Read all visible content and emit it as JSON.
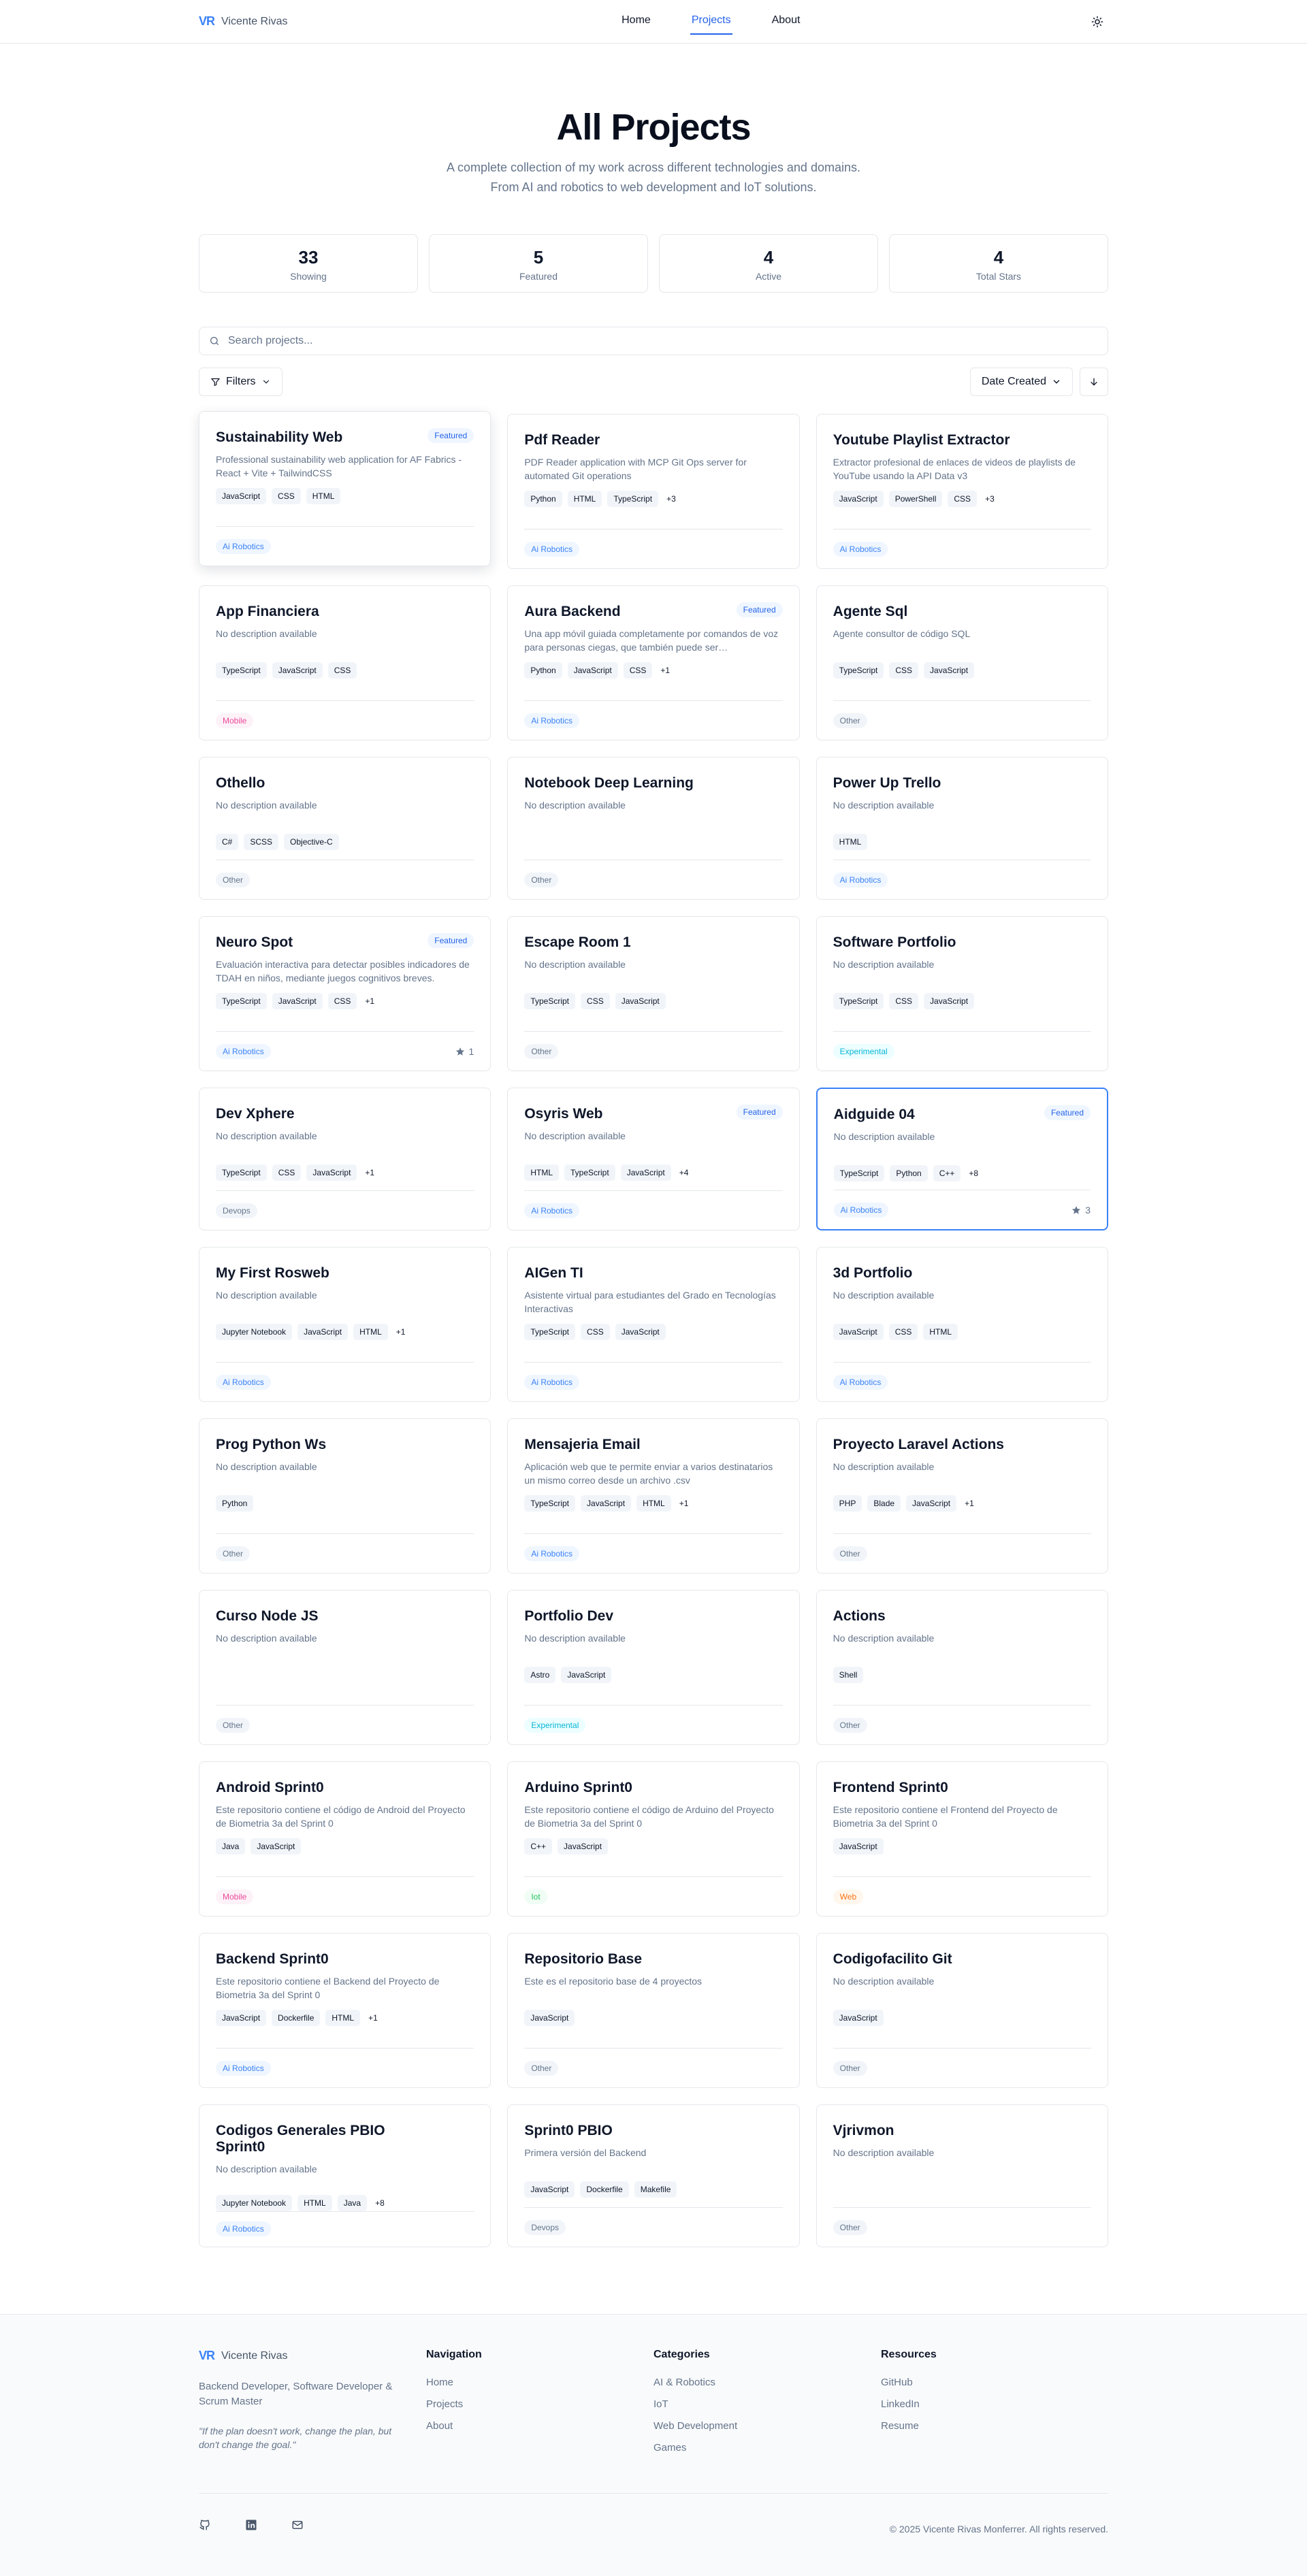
{
  "nav": {
    "brand_logo": "VR",
    "brand_name": "Vicente Rivas",
    "links": [
      "Home",
      "Projects",
      "About"
    ]
  },
  "hero": {
    "title": "All Projects",
    "subtitle_line1": "A complete collection of my work across different technologies and domains.",
    "subtitle_line2": "From AI and robotics to web development and IoT solutions."
  },
  "stats": [
    {
      "value": "33",
      "label": "Showing"
    },
    {
      "value": "5",
      "label": "Featured"
    },
    {
      "value": "4",
      "label": "Active"
    },
    {
      "value": "4",
      "label": "Total Stars"
    }
  ],
  "search": {
    "placeholder": "Search projects..."
  },
  "filters": {
    "label": "Filters",
    "sort_value": "Date Created"
  },
  "featured_label": "Featured",
  "projects": [
    {
      "title": "Sustainability Web",
      "featured": true,
      "desc": "Professional sustainability web application for AF Fabrics - React + Vite + TailwindCSS",
      "tags": [
        "JavaScript",
        "CSS",
        "HTML"
      ],
      "more": "",
      "category": "Ai Robotics",
      "cat": "ai",
      "stars": ""
    },
    {
      "title": "Pdf Reader",
      "featured": false,
      "desc": "PDF Reader application with MCP Git Ops server for automated Git operations",
      "tags": [
        "Python",
        "HTML",
        "TypeScript"
      ],
      "more": "+3",
      "category": "Ai Robotics",
      "cat": "ai",
      "stars": ""
    },
    {
      "title": "Youtube Playlist Extractor",
      "featured": false,
      "desc": "Extractor profesional de enlaces de videos de playlists de YouTube usando la API Data v3",
      "tags": [
        "JavaScript",
        "PowerShell",
        "CSS"
      ],
      "more": "+3",
      "category": "Ai Robotics",
      "cat": "ai",
      "stars": ""
    },
    {
      "title": "App Financiera",
      "featured": false,
      "desc": "No description available",
      "tags": [
        "TypeScript",
        "JavaScript",
        "CSS"
      ],
      "more": "",
      "category": "Mobile",
      "cat": "mobile",
      "stars": ""
    },
    {
      "title": "Aura Backend",
      "featured": true,
      "desc": "Una app móvil guiada completamente por comandos de voz para personas ciegas, que también puede ser…",
      "tags": [
        "Python",
        "JavaScript",
        "CSS"
      ],
      "more": "+1",
      "category": "Ai Robotics",
      "cat": "ai",
      "stars": ""
    },
    {
      "title": "Agente Sql",
      "featured": false,
      "desc": "Agente consultor de código SQL",
      "tags": [
        "TypeScript",
        "CSS",
        "JavaScript"
      ],
      "more": "",
      "category": "Other",
      "cat": "other",
      "stars": ""
    },
    {
      "title": "Othello",
      "featured": false,
      "desc": "No description available",
      "tags": [
        "C#",
        "SCSS",
        "Objective-C"
      ],
      "more": "",
      "category": "Other",
      "cat": "other",
      "stars": ""
    },
    {
      "title": "Notebook Deep Learning",
      "featured": false,
      "desc": "No description available",
      "tags": [],
      "more": "",
      "category": "Other",
      "cat": "other",
      "stars": ""
    },
    {
      "title": "Power Up Trello",
      "featured": false,
      "desc": "No description available",
      "tags": [
        "HTML"
      ],
      "more": "",
      "category": "Ai Robotics",
      "cat": "ai",
      "stars": ""
    },
    {
      "title": "Neuro Spot",
      "featured": true,
      "desc": "Evaluación interactiva para detectar posibles indicadores de TDAH en niños, mediante juegos cognitivos breves.",
      "tags": [
        "TypeScript",
        "JavaScript",
        "CSS"
      ],
      "more": "+1",
      "category": "Ai Robotics",
      "cat": "ai",
      "stars": "1"
    },
    {
      "title": "Escape Room 1",
      "featured": false,
      "desc": "No description available",
      "tags": [
        "TypeScript",
        "CSS",
        "JavaScript"
      ],
      "more": "",
      "category": "Other",
      "cat": "other",
      "stars": ""
    },
    {
      "title": "Software Portfolio",
      "featured": false,
      "desc": "No description available",
      "tags": [
        "TypeScript",
        "CSS",
        "JavaScript"
      ],
      "more": "",
      "category": "Experimental",
      "cat": "exp",
      "stars": ""
    },
    {
      "title": "Dev Xphere",
      "featured": false,
      "desc": "No description available",
      "tags": [
        "TypeScript",
        "CSS",
        "JavaScript"
      ],
      "more": "+1",
      "category": "Devops",
      "cat": "devops",
      "stars": ""
    },
    {
      "title": "Osyris Web",
      "featured": true,
      "desc": "No description available",
      "tags": [
        "HTML",
        "TypeScript",
        "JavaScript"
      ],
      "more": "+4",
      "category": "Ai Robotics",
      "cat": "ai",
      "stars": ""
    },
    {
      "title": "Aidguide 04",
      "featured": true,
      "desc": "No description available",
      "tags": [
        "TypeScript",
        "Python",
        "C++"
      ],
      "more": "+8",
      "category": "Ai Robotics",
      "cat": "ai",
      "stars": "3"
    },
    {
      "title": "My First Rosweb",
      "featured": false,
      "desc": "No description available",
      "tags": [
        "Jupyter Notebook",
        "JavaScript",
        "HTML"
      ],
      "more": "+1",
      "category": "Ai Robotics",
      "cat": "ai",
      "stars": ""
    },
    {
      "title": "AIGen TI",
      "featured": false,
      "desc": "Asistente virtual para estudiantes del Grado en Tecnologías Interactivas",
      "tags": [
        "TypeScript",
        "CSS",
        "JavaScript"
      ],
      "more": "",
      "category": "Ai Robotics",
      "cat": "ai",
      "stars": ""
    },
    {
      "title": "3d Portfolio",
      "featured": false,
      "desc": "No description available",
      "tags": [
        "JavaScript",
        "CSS",
        "HTML"
      ],
      "more": "",
      "category": "Ai Robotics",
      "cat": "ai",
      "stars": ""
    },
    {
      "title": "Prog Python Ws",
      "featured": false,
      "desc": "No description available",
      "tags": [
        "Python"
      ],
      "more": "",
      "category": "Other",
      "cat": "other",
      "stars": ""
    },
    {
      "title": "Mensajeria Email",
      "featured": false,
      "desc": "Aplicación web que te permite enviar a varios destinatarios un mismo correo desde un archivo .csv",
      "tags": [
        "TypeScript",
        "JavaScript",
        "HTML"
      ],
      "more": "+1",
      "category": "Ai Robotics",
      "cat": "ai",
      "stars": ""
    },
    {
      "title": "Proyecto Laravel Actions",
      "featured": false,
      "desc": "No description available",
      "tags": [
        "PHP",
        "Blade",
        "JavaScript"
      ],
      "more": "+1",
      "category": "Other",
      "cat": "other",
      "stars": ""
    },
    {
      "title": "Curso Node JS",
      "featured": false,
      "desc": "No description available",
      "tags": [],
      "more": "",
      "category": "Other",
      "cat": "other",
      "stars": ""
    },
    {
      "title": "Portfolio Dev",
      "featured": false,
      "desc": "No description available",
      "tags": [
        "Astro",
        "JavaScript"
      ],
      "more": "",
      "category": "Experimental",
      "cat": "exp",
      "stars": ""
    },
    {
      "title": "Actions",
      "featured": false,
      "desc": "No description available",
      "tags": [
        "Shell"
      ],
      "more": "",
      "category": "Other",
      "cat": "other",
      "stars": ""
    },
    {
      "title": "Android Sprint0",
      "featured": false,
      "desc": "Este repositorio contiene el código de Android del Proyecto de Biometria 3a del Sprint 0",
      "tags": [
        "Java",
        "JavaScript"
      ],
      "more": "",
      "category": "Mobile",
      "cat": "mobile",
      "stars": ""
    },
    {
      "title": "Arduino Sprint0",
      "featured": false,
      "desc": "Este repositorio contiene el código de Arduino del Proyecto de Biometria 3a del Sprint 0",
      "tags": [
        "C++",
        "JavaScript"
      ],
      "more": "",
      "category": "Iot",
      "cat": "iot",
      "stars": ""
    },
    {
      "title": "Frontend Sprint0",
      "featured": false,
      "desc": "Este repositorio contiene el Frontend del Proyecto de Biometria 3a del Sprint 0",
      "tags": [
        "JavaScript"
      ],
      "more": "",
      "category": "Web",
      "cat": "web",
      "stars": ""
    },
    {
      "title": "Backend Sprint0",
      "featured": false,
      "desc": "Este repositorio contiene el Backend del Proyecto de Biometria 3a del Sprint 0",
      "tags": [
        "JavaScript",
        "Dockerfile",
        "HTML"
      ],
      "more": "+1",
      "category": "Ai Robotics",
      "cat": "ai",
      "stars": ""
    },
    {
      "title": "Repositorio Base",
      "featured": false,
      "desc": "Este es el repositorio base de 4 proyectos",
      "tags": [
        "JavaScript"
      ],
      "more": "",
      "category": "Other",
      "cat": "other",
      "stars": ""
    },
    {
      "title": "Codigofacilito Git",
      "featured": false,
      "desc": "No description available",
      "tags": [
        "JavaScript"
      ],
      "more": "",
      "category": "Other",
      "cat": "other",
      "stars": ""
    },
    {
      "title": "Codigos Generales PBIO Sprint0",
      "featured": false,
      "desc": "No description available",
      "tags": [
        "Jupyter Notebook",
        "HTML",
        "Java"
      ],
      "more": "+8",
      "category": "Ai Robotics",
      "cat": "ai",
      "stars": ""
    },
    {
      "title": "Sprint0 PBIO",
      "featured": false,
      "desc": "Primera versión del Backend",
      "tags": [
        "JavaScript",
        "Dockerfile",
        "Makefile"
      ],
      "more": "",
      "category": "Devops",
      "cat": "devops",
      "stars": ""
    },
    {
      "title": "Vjrivmon",
      "featured": false,
      "desc": "No description available",
      "tags": [],
      "more": "",
      "category": "Other",
      "cat": "other",
      "stars": ""
    }
  ],
  "footer": {
    "brand_logo": "VR",
    "brand_name": "Vicente Rivas",
    "bio": "Backend Developer, Software Developer & Scrum Master",
    "quote": "\"If the plan doesn't work, change the plan, but don't change the goal.\"",
    "columns": [
      {
        "heading": "Navigation",
        "items": [
          "Home",
          "Projects",
          "About"
        ]
      },
      {
        "heading": "Categories",
        "items": [
          "AI & Robotics",
          "IoT",
          "Web Development",
          "Games"
        ]
      },
      {
        "heading": "Resources",
        "items": [
          "GitHub",
          "LinkedIn",
          "Resume"
        ]
      }
    ],
    "copyright": "© 2025 Vicente Rivas Monferrer. All rights reserved."
  }
}
